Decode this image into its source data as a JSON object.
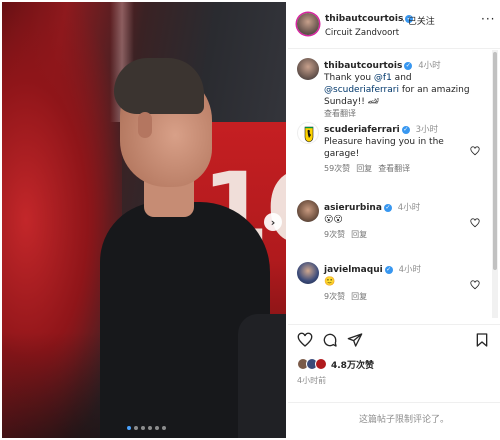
{
  "post_header": {
    "username": "thibautcourtois",
    "follow_status": "已关注",
    "location": "Circuit Zandvoort"
  },
  "comments": [
    {
      "username": "thibautcourtois",
      "time": "4小时",
      "text_before": "Thank you ",
      "mention1": "@f1",
      "text_middle": " and ",
      "mention2": "@scuderiaferrari",
      "text_after": " for an amazing Sunday!! 🏎",
      "translate": "查看翻译"
    },
    {
      "username": "scuderiaferrari",
      "time": "3小时",
      "text": "Pleasure having you in the garage!",
      "likes": "59次赞",
      "reply": "回复",
      "translate": "查看翻译"
    },
    {
      "username": "asierurbina",
      "time": "4小时",
      "text": "😮😮",
      "likes": "9次赞",
      "reply": "回复"
    },
    {
      "username": "javielmaqui",
      "time": "4小时",
      "text": "🙂",
      "likes": "9次赞",
      "reply": "回复"
    }
  ],
  "engagement": {
    "likes": "4.8万次赞",
    "posted": "4小时前"
  },
  "comments_limited": "这篇帖子限制评论了。",
  "carousel": {
    "slides": 6,
    "active_index": 0
  },
  "colors": {
    "verified": "#3897f0",
    "ferrari_yellow": "#ffd400",
    "mention": "#00376b"
  },
  "icons": [
    "verified-icon",
    "more-icon",
    "heart-icon",
    "comment-icon",
    "share-icon",
    "bookmark-icon",
    "chevron-right-icon"
  ]
}
